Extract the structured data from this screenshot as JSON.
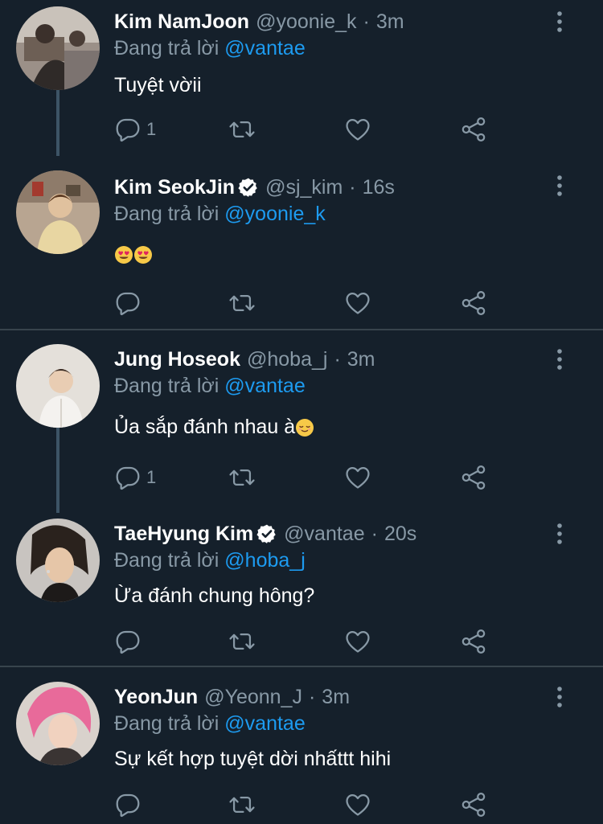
{
  "colors": {
    "background": "#15202b",
    "secondary_text": "#8899a6",
    "mention": "#1d9bf0",
    "divider": "#38444d",
    "thread_line": "#3d5466"
  },
  "tweets": [
    {
      "name": "Kim NamJoon",
      "verified": false,
      "handle": "@yoonie_k",
      "time": "3m",
      "replying_prefix": "Đang trả lời",
      "replying_to": "@vantae",
      "text": "Tuyệt vờii",
      "reply_count": "1",
      "icons": [
        "reply-icon",
        "retweet-icon",
        "like-icon",
        "share-icon",
        "more-icon"
      ]
    },
    {
      "name": "Kim SeokJin",
      "verified": true,
      "handle": "@sj_kim",
      "time": "16s",
      "replying_prefix": "Đang trả lời",
      "replying_to": "@yoonie_k",
      "text": "😍😍",
      "reply_count": "",
      "icons": [
        "reply-icon",
        "retweet-icon",
        "like-icon",
        "share-icon",
        "more-icon"
      ]
    },
    {
      "name": "Jung Hoseok",
      "verified": false,
      "handle": "@hoba_j",
      "time": "3m",
      "replying_prefix": "Đang trả lời",
      "replying_to": "@vantae",
      "text": "Ủa sắp đánh nhau à",
      "text_emoji": "😌",
      "reply_count": "1",
      "icons": [
        "reply-icon",
        "retweet-icon",
        "like-icon",
        "share-icon",
        "more-icon"
      ]
    },
    {
      "name": "TaeHyung Kim",
      "verified": true,
      "handle": "@vantae",
      "time": "20s",
      "replying_prefix": "Đang trả lời",
      "replying_to": "@hoba_j",
      "text": "Ừa đánh chung hông?",
      "reply_count": "",
      "icons": [
        "reply-icon",
        "retweet-icon",
        "like-icon",
        "share-icon",
        "more-icon"
      ]
    },
    {
      "name": "YeonJun",
      "verified": false,
      "handle": "@Yeonn_J",
      "time": "3m",
      "replying_prefix": "Đang trả lời",
      "replying_to": "@vantae",
      "text": "Sự kết hợp tuyệt dời nhấttt hihi",
      "reply_count": "",
      "icons": [
        "reply-icon",
        "retweet-icon",
        "like-icon",
        "share-icon",
        "more-icon"
      ]
    }
  ]
}
